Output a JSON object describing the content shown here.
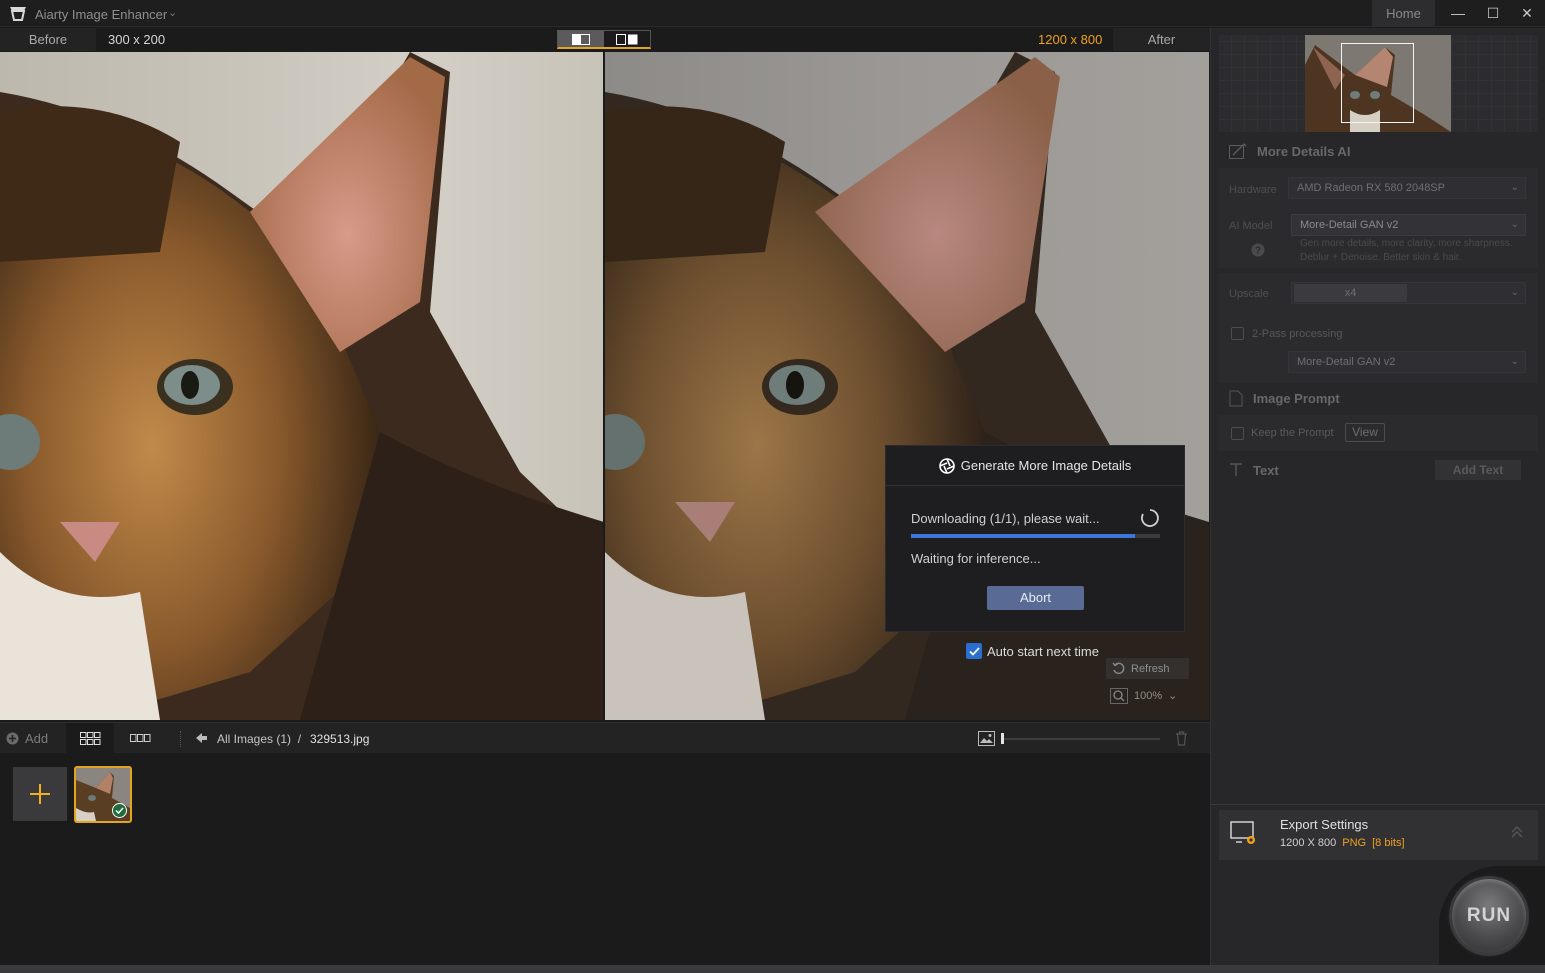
{
  "app": {
    "title": "Aiarty Image Enhancer",
    "home_label": "Home",
    "window_controls": [
      "minimize-icon",
      "maximize-icon",
      "close-icon"
    ]
  },
  "compare": {
    "before_label": "Before",
    "before_size": "300 x 200",
    "after_size": "1200 x 800",
    "after_label": "After"
  },
  "dialog": {
    "title": "Generate More Image Details",
    "downloading": "Downloading (1/1), please wait...",
    "progress": 0.9,
    "waiting": "Waiting for inference...",
    "abort_label": "Abort"
  },
  "auto_start": {
    "label": "Auto start next time",
    "checked": true
  },
  "viewer_tools": {
    "refresh_label": "Refresh",
    "zoom_label": "100%"
  },
  "toolbar": {
    "add_label": "Add",
    "breadcrumb_root": "All Images (1)",
    "breadcrumb_sep": "/",
    "breadcrumb_file": "329513.jpg",
    "thumb_slider": 0.0
  },
  "side": {
    "section_ai": "More Details AI",
    "hardware_label": "Hardware",
    "hardware_value": "AMD Radeon RX 580 2048SP",
    "model_label": "AI Model",
    "model_value": "More-Detail GAN v2",
    "model_hint_1": "Gen more details, more clarity, more sharpness.",
    "model_hint_2": "Deblur + Denoise. Better skin & hair.",
    "upscale_label": "Upscale",
    "upscale_value": "x4",
    "twopass_label": "2-Pass processing",
    "twopass_model": "More-Detail GAN v2",
    "section_prompt": "Image Prompt",
    "keep_prompt_label": "Keep the Prompt",
    "view_label": "View",
    "section_text": "Text",
    "add_text_label": "Add Text"
  },
  "export": {
    "title": "Export Settings",
    "size": "1200 X 800",
    "format": "PNG",
    "bits": "[8 bits]"
  },
  "run_label": "RUN",
  "colors": {
    "accent": "#e3a41f",
    "progress": "#3b76d8",
    "abort": "#596a94"
  }
}
